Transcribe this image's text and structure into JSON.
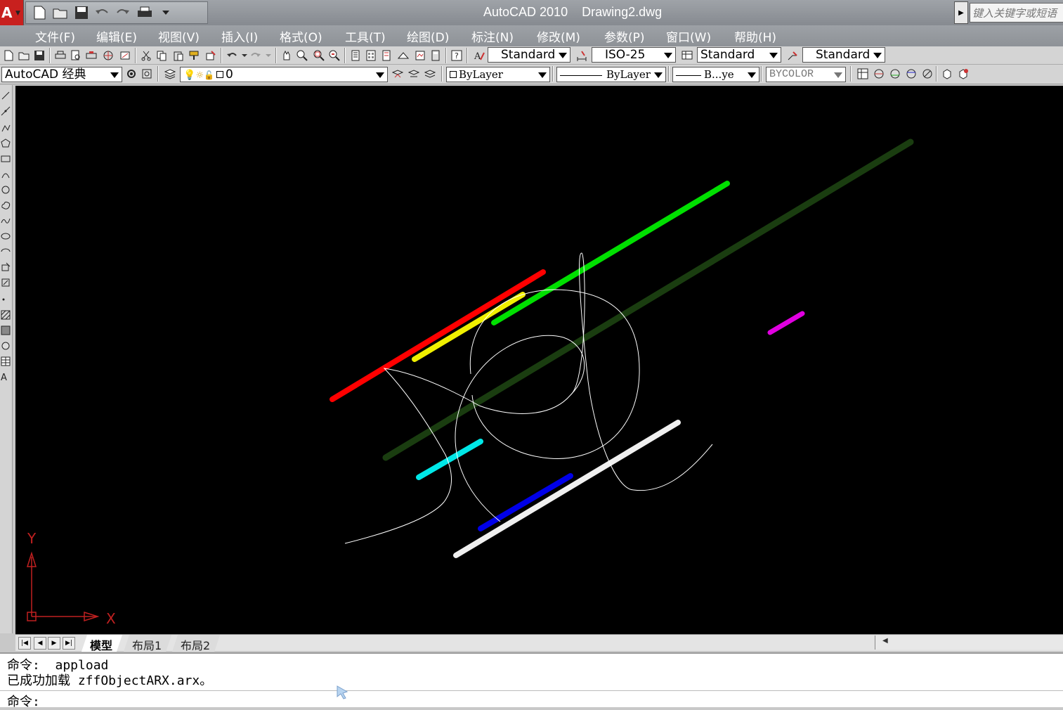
{
  "window": {
    "app_name": "AutoCAD 2010",
    "doc_name": "Drawing2.dwg",
    "search_placeholder": "键入关键字或短语"
  },
  "menu": [
    "文件(F)",
    "编辑(E)",
    "视图(V)",
    "插入(I)",
    "格式(O)",
    "工具(T)",
    "绘图(D)",
    "标注(N)",
    "修改(M)",
    "参数(P)",
    "窗口(W)",
    "帮助(H)"
  ],
  "styles": {
    "text_style": "Standard",
    "dim_style": "ISO-25",
    "table_style": "Standard",
    "mleader_style": "Standard"
  },
  "workspace": "AutoCAD 经典",
  "layer": "0",
  "properties": {
    "color": "ByLayer",
    "linetype": "ByLayer",
    "lineweight": "B...ye",
    "plotstyle": "BYCOLOR"
  },
  "ucs": {
    "x_label": "X",
    "y_label": "Y"
  },
  "layout_tabs": [
    "模型",
    "布局1",
    "布局2"
  ],
  "command": {
    "lines": [
      "命令:  appload",
      "已成功加载 zffObjectARX.arx。"
    ],
    "prompt": "命令:"
  },
  "colors": {
    "red": "#ff0000",
    "yellow": "#f0f000",
    "green": "#00e000",
    "dark_green": "#1a3d10",
    "magenta": "#e000e0",
    "cyan": "#00e8e8",
    "blue": "#0000e8",
    "white": "#f0f0f0",
    "ucs": "#c02020"
  }
}
